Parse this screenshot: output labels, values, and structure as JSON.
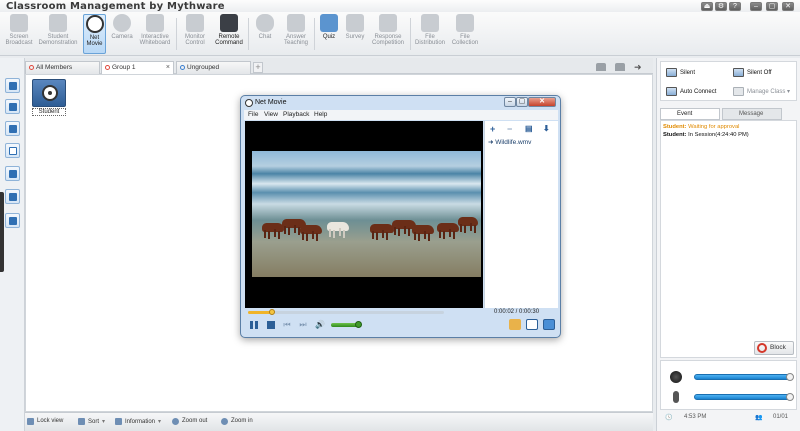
{
  "app": {
    "title": "Classroom Management by Mythware",
    "window_buttons": [
      "⏏",
      "⚙",
      "?",
      "–",
      "▢",
      "✕"
    ]
  },
  "toolbar": [
    {
      "label": "Screen Broadcast",
      "icon": "screen-broadcast-icon",
      "state": "disabled"
    },
    {
      "label": "Student Demonstration",
      "icon": "student-demonstration-icon",
      "state": "disabled"
    },
    {
      "label": "Net Movie",
      "icon": "film-reel-icon",
      "state": "active"
    },
    {
      "label": "Camera",
      "icon": "camera-icon",
      "state": "disabled"
    },
    {
      "label": "Interactive Whiteboard",
      "icon": "whiteboard-icon",
      "state": "disabled"
    },
    {
      "label": "Monitor Control",
      "icon": "monitor-control-icon",
      "state": "disabled"
    },
    {
      "label": "Remote Command",
      "icon": "remote-command-icon",
      "state": "enabled"
    },
    {
      "label": "Chat",
      "icon": "chat-icon",
      "state": "disabled"
    },
    {
      "label": "Answer Teaching",
      "icon": "answer-teaching-icon",
      "state": "disabled"
    },
    {
      "label": "Quiz",
      "icon": "quiz-icon",
      "state": "enabled"
    },
    {
      "label": "Survey",
      "icon": "survey-icon",
      "state": "disabled"
    },
    {
      "label": "Response Competition",
      "icon": "response-competition-icon",
      "state": "disabled"
    },
    {
      "label": "File Distribution",
      "icon": "file-distribution-icon",
      "state": "disabled"
    },
    {
      "label": "File Collection",
      "icon": "file-collection-icon",
      "state": "disabled"
    }
  ],
  "tabs": [
    {
      "label": "All Members",
      "active": false
    },
    {
      "label": "Group 1",
      "active": true
    },
    {
      "label": "Ungrouped",
      "active": false
    }
  ],
  "student": {
    "name": "Student"
  },
  "statusbar": {
    "lock_view": "Lock view",
    "sort": "Sort",
    "information": "Information",
    "zoom_out": "Zoom out",
    "zoom_in": "Zoom in"
  },
  "netmovie": {
    "title": "Net Movie",
    "menu": [
      "File",
      "View",
      "Playback",
      "Help"
    ],
    "playlist_item": "Wildlife.wmv",
    "timecode": "0:00:02 / 0:00:30",
    "progress": 0.12,
    "volume": 0.85
  },
  "right_panel": {
    "silent": "Silent",
    "silent_off": "Silent Off",
    "auto_connect": "Auto Connect",
    "manage_class": "Manage Class",
    "event_tab": "Event",
    "message_tab": "Message",
    "events": [
      {
        "who": "Student:",
        "text": " Waiting for approval",
        "kind": "warn"
      },
      {
        "who": "Student:",
        "text": " In Session(4:24:40 PM)",
        "kind": "ok"
      }
    ],
    "block": "Block",
    "speaker_level": 1.0,
    "mic_level": 1.0,
    "clock": "4:53 PM",
    "count": "01/01"
  }
}
